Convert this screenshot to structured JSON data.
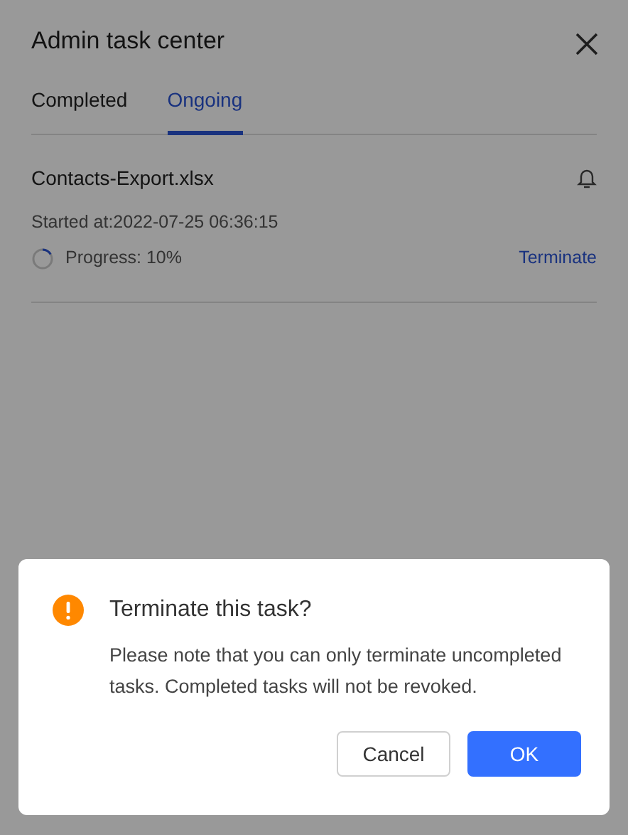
{
  "panel": {
    "title": "Admin task center"
  },
  "tabs": [
    {
      "label": "Completed",
      "selected": false
    },
    {
      "label": "Ongoing",
      "selected": true
    }
  ],
  "tasks": [
    {
      "name": "Contacts-Export.xlsx",
      "started": "Started at:2022-07-25 06:36:15",
      "progress": "Progress: 10%",
      "action": "Terminate"
    }
  ],
  "dialog": {
    "title": "Terminate this task?",
    "message": "Please note that you can only terminate uncompleted tasks. Completed tasks will not be revoked.",
    "buttons": [
      {
        "label": "Cancel",
        "kind": "secondary"
      },
      {
        "label": "OK",
        "kind": "primary"
      }
    ]
  }
}
